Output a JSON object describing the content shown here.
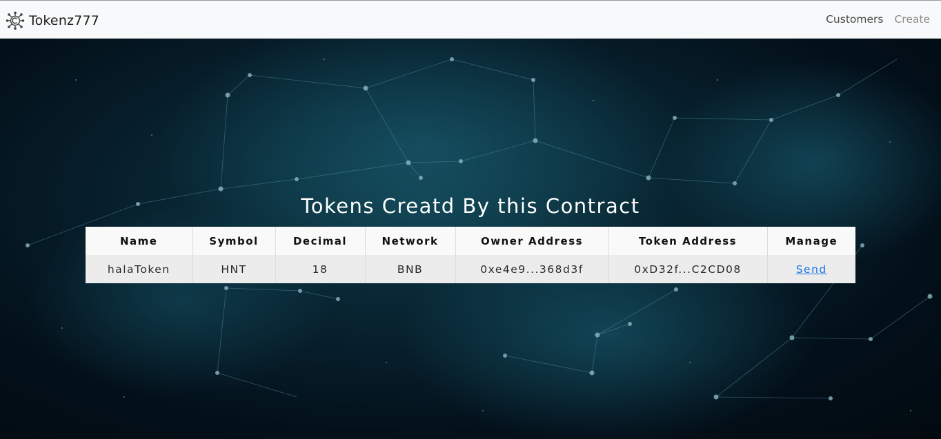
{
  "navbar": {
    "brand": {
      "name": "Tokenz777",
      "icon": "chain-network-logo-icon"
    },
    "links": [
      {
        "label": "Customers",
        "state": "active"
      },
      {
        "label": "Create",
        "state": "inactive"
      }
    ]
  },
  "main": {
    "heading": "Tokens Creatd By this Contract",
    "table": {
      "columns": [
        "Name",
        "Symbol",
        "Decimal",
        "Network",
        "Owner Address",
        "Token Address",
        "Manage"
      ],
      "rows": [
        {
          "name": "halaToken",
          "symbol": "HNT",
          "decimal": "18",
          "network": "BNB",
          "owner_address": "0xe4e9...368d3f",
          "token_address": "0xD32f...C2CD08",
          "manage_label": "Send"
        }
      ]
    }
  },
  "colors": {
    "navbar_bg": "#f8f9fa",
    "hero_bg": "#082431",
    "link_blue": "#1a73e8"
  }
}
